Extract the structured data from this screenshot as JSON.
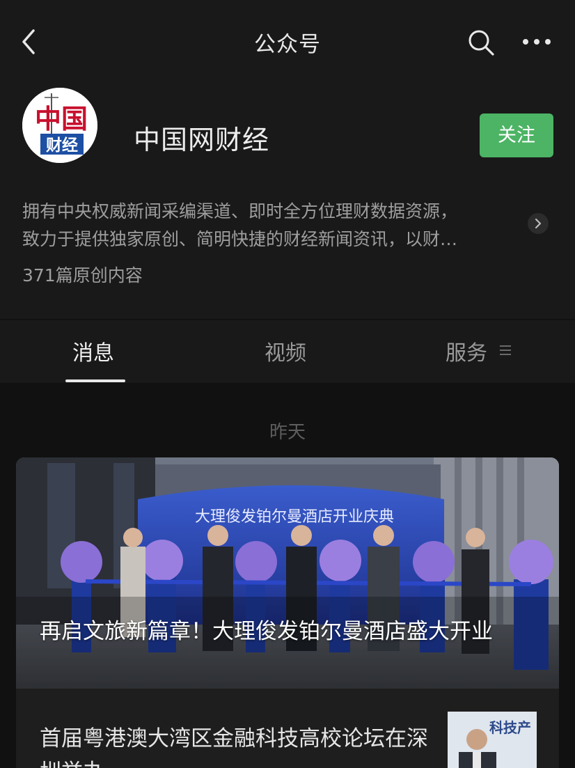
{
  "nav": {
    "title": "公众号",
    "back_icon": "chevron-left-icon",
    "search_icon": "search-icon",
    "more_icon": "more-icon"
  },
  "account": {
    "logo_line1": "中国",
    "logo_line2": "财经",
    "name": "中国网财经",
    "follow_label": "关注",
    "desc_line1": "拥有中央权威新闻采编渠道、即时全方位理财数据资源，",
    "desc_line2": "致力于提供独家原创、简明快捷的财经新闻资讯，以财…",
    "original_count": "371篇原创内容"
  },
  "tabs": [
    {
      "label": "消息",
      "active": true
    },
    {
      "label": "视频",
      "active": false
    },
    {
      "label": "服务",
      "active": false
    }
  ],
  "feed": {
    "date_label": "昨天",
    "cover_banner": "大理俊发铂尔曼酒店开业庆典",
    "cover_title": "再启文旅新篇章！大理俊发铂尔曼酒店盛大开业",
    "item2_title": "首届粤港澳大湾区金融科技高校论坛在深圳举办",
    "item2_thumb_text": "科技产"
  },
  "colors": {
    "background": "#111111",
    "surface": "#191919",
    "follow_button": "#4cb464",
    "text_primary": "#e6e6e6",
    "text_secondary": "#9e9e9e",
    "brand_red": "#c8102e",
    "brand_blue": "#1d4fa3"
  }
}
